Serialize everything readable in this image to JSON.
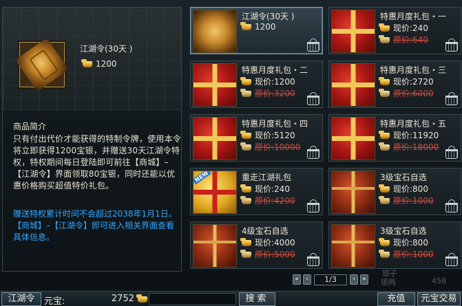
{
  "detail": {
    "name": "江湖令(30天 )",
    "price": "1200",
    "section_title": "商品简介",
    "description": "只有付出代价才能获得的特制令牌，使用本令将立即获得1200宝银，并赠送30天江湖令特权，特权期间每日登陆即可前往【商城】–【江湖令】界面领取80宝银，同时还能以优惠价格购买超值特价礼包。",
    "note": "赠送特权累计时间不会超过2038年1月1日。【商城】–【江湖令】即可进入相关界面查看具体信息。"
  },
  "items": [
    {
      "title": "江湖令(30天 )",
      "line1": "1200",
      "line2": "",
      "icon": "token-icon",
      "selected": true
    },
    {
      "title": "特惠月度礼包・一",
      "line1": "现价:240",
      "line2": "原价:640",
      "icon": "red-gift-icon",
      "selected": false
    },
    {
      "title": "特惠月度礼包・二",
      "line1": "现价:1200",
      "line2": "原价:3200",
      "icon": "red-gift-icon",
      "selected": false
    },
    {
      "title": "特惠月度礼包・三",
      "line1": "现价:2720",
      "line2": "原价:6000",
      "icon": "red-gift-icon",
      "selected": false
    },
    {
      "title": "特惠月度礼包・四",
      "line1": "现价:5120",
      "line2": "原价:10000",
      "icon": "red-gift-icon",
      "selected": false
    },
    {
      "title": "特惠月度礼包・五",
      "line1": "现价:11920",
      "line2": "原价:18000",
      "icon": "red-gift-icon",
      "selected": false
    },
    {
      "title": "重走江湖礼包",
      "line1": "现价:240",
      "line2": "原价:4200",
      "icon": "gold-gift-icon",
      "selected": false,
      "badge": "NEW"
    },
    {
      "title": "3级宝石自选",
      "line1": "现价:800",
      "line2": "原价:1000",
      "icon": "chest-icon",
      "selected": false
    },
    {
      "title": "4级宝石自选",
      "line1": "现价:4000",
      "line2": "原价:5000",
      "icon": "chest-icon",
      "selected": false
    },
    {
      "title": "3级宝石自选",
      "line1": "现价:800",
      "line2": "原价:1000",
      "icon": "chest-icon",
      "selected": false
    }
  ],
  "pager": {
    "page_text": "1/3"
  },
  "bottom": {
    "tab_label": "江湖令",
    "currency_label": "元宝:",
    "currency_value": "2752",
    "search_label": "搜索",
    "recharge_label": "充值",
    "exchange_label": "元宝交易"
  },
  "faint": {
    "a": "银两",
    "b": "458",
    "c": "银子"
  },
  "colors": {
    "accent_blue": "#36a6ff",
    "strike_red": "#d24a3c"
  }
}
